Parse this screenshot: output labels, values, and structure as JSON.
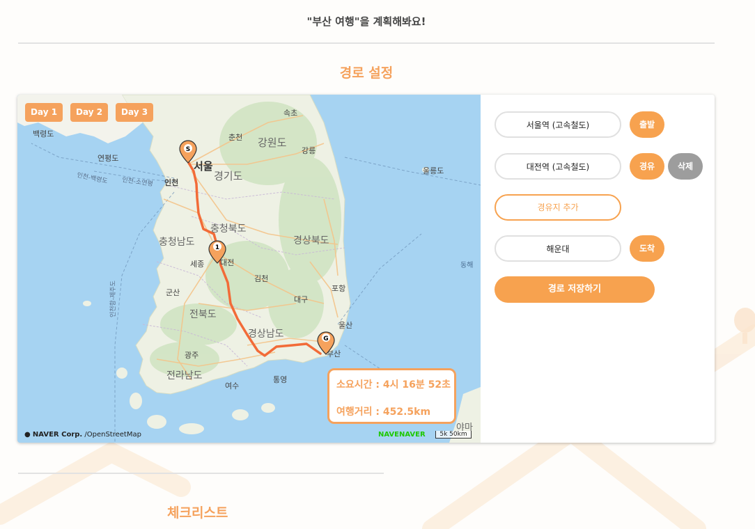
{
  "header": {
    "title_partial": "",
    "subtitle": "\"부산 여행\"을 계획해봐요!"
  },
  "route_section": {
    "title": "경로 설정"
  },
  "checklist_section": {
    "title": "체크리스트"
  },
  "map": {
    "days": [
      "Day 1",
      "Day 2",
      "Day 3"
    ],
    "markers": {
      "start": "S",
      "waypoint": "1",
      "goal": "G"
    },
    "place_labels": {
      "seoul": "서울",
      "incheon": "인천",
      "chuncheon": "춘천",
      "sokcho": "속초",
      "gangwon": "강원도",
      "gangneung": "강릉",
      "gyeonggi": "경기도",
      "chungbuk": "충청북도",
      "chungnam": "충청남도",
      "sejong": "세종",
      "daejeon": "대전",
      "gyeongbuk": "경상북도",
      "gimcheon": "김천",
      "gunsan": "군산",
      "jeonbuk": "전북도",
      "daegu": "대구",
      "pohang": "포항",
      "ulsan": "울산",
      "gyeongnam": "경상남도",
      "busan": "부산",
      "gwangju": "광주",
      "jeonnam": "전라남도",
      "yeosu": "여수",
      "tongyeong": "통영",
      "ulleungdo": "울릉도",
      "baengnyeongdo": "백령도",
      "yeonpyeongdo": "연평도",
      "east_sea": "동해",
      "route_incheon_baengnyeong": "인천-백령도",
      "route_incheon_soyeonpyeong": "인천-소연평",
      "route_incheon_jeju": "인천항-제주도",
      "yamaguchi": "야마"
    },
    "info": {
      "duration": "소요시간 : 4시 16분 52초",
      "distance": "여행거리 : 452.5km"
    },
    "attribution": {
      "corp": "NAVER Corp.",
      "osm": " /OpenStreetMap"
    },
    "naver_logo": "NAVENAVER",
    "scale": "5k 50km"
  },
  "route_panel": {
    "start": {
      "value": "서울역 (고속철도)",
      "badge": "출발"
    },
    "waypoint": {
      "value": "대전역 (고속철도)",
      "badge": "경유",
      "delete": "삭제"
    },
    "add_waypoint": "경유지 추가",
    "end": {
      "value": "해운대",
      "badge": "도착"
    },
    "save": "경로 저장하기"
  },
  "colors": {
    "accent": "#f5a25d",
    "route": "#f26b38",
    "gray_button": "#9d9d9d"
  }
}
